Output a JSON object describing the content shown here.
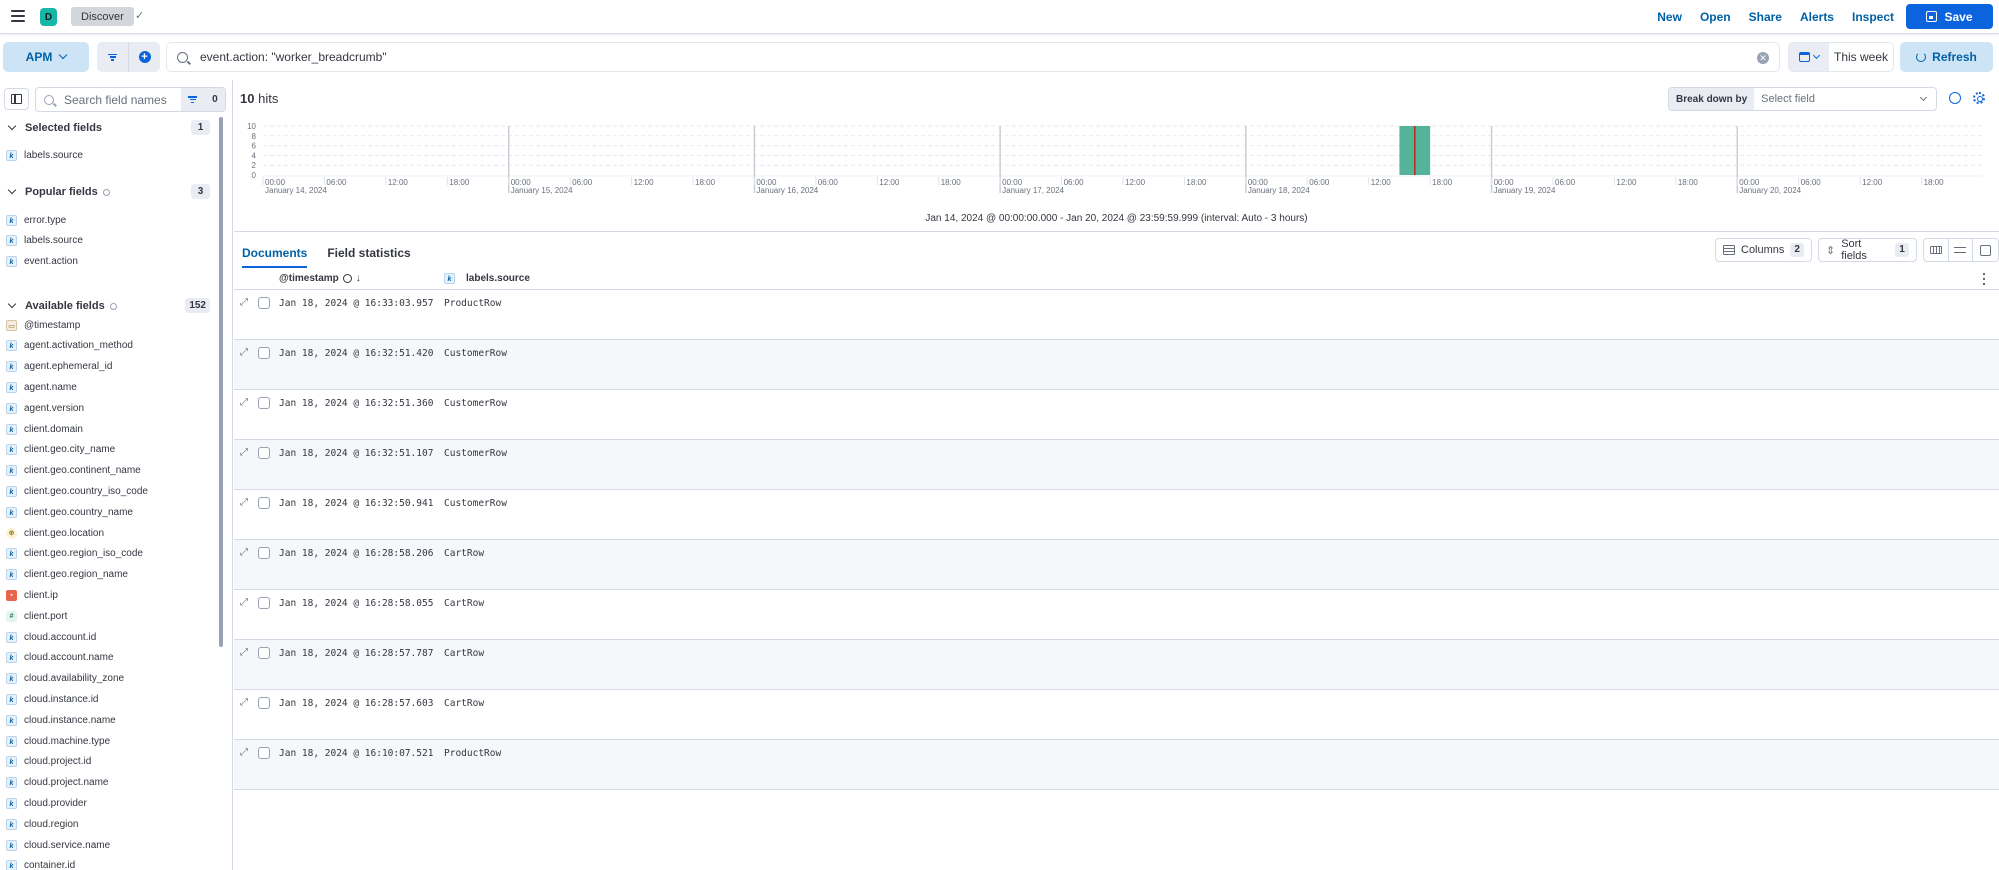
{
  "header": {
    "space_initial": "D",
    "breadcrumb": "Discover",
    "nav_links": [
      "New",
      "Open",
      "Share",
      "Alerts",
      "Inspect"
    ],
    "save_label": "Save"
  },
  "querybar": {
    "data_view": "APM",
    "query": "event.action: \"worker_breadcrumb\"",
    "date_range": "This week",
    "refresh_label": "Refresh"
  },
  "sidebar": {
    "search_placeholder": "Search field names",
    "filter_count": "0",
    "selected": {
      "title": "Selected fields",
      "count": "1",
      "fields": [
        {
          "name": "labels.source",
          "type": "k"
        }
      ]
    },
    "popular": {
      "title": "Popular fields",
      "count": "3",
      "fields": [
        {
          "name": "error.type",
          "type": "k"
        },
        {
          "name": "labels.source",
          "type": "k"
        },
        {
          "name": "event.action",
          "type": "k"
        }
      ]
    },
    "available": {
      "title": "Available fields",
      "count": "152",
      "fields": [
        {
          "name": "@timestamp",
          "type": "date"
        },
        {
          "name": "agent.activation_method",
          "type": "k"
        },
        {
          "name": "agent.ephemeral_id",
          "type": "k"
        },
        {
          "name": "agent.name",
          "type": "k"
        },
        {
          "name": "agent.version",
          "type": "k"
        },
        {
          "name": "client.domain",
          "type": "k"
        },
        {
          "name": "client.geo.city_name",
          "type": "k"
        },
        {
          "name": "client.geo.continent_name",
          "type": "k"
        },
        {
          "name": "client.geo.country_iso_code",
          "type": "k"
        },
        {
          "name": "client.geo.country_name",
          "type": "k"
        },
        {
          "name": "client.geo.location",
          "type": "geo"
        },
        {
          "name": "client.geo.region_iso_code",
          "type": "k"
        },
        {
          "name": "client.geo.region_name",
          "type": "k"
        },
        {
          "name": "client.ip",
          "type": "ip"
        },
        {
          "name": "client.port",
          "type": "num"
        },
        {
          "name": "cloud.account.id",
          "type": "k"
        },
        {
          "name": "cloud.account.name",
          "type": "k"
        },
        {
          "name": "cloud.availability_zone",
          "type": "k"
        },
        {
          "name": "cloud.instance.id",
          "type": "k"
        },
        {
          "name": "cloud.instance.name",
          "type": "k"
        },
        {
          "name": "cloud.machine.type",
          "type": "k"
        },
        {
          "name": "cloud.project.id",
          "type": "k"
        },
        {
          "name": "cloud.project.name",
          "type": "k"
        },
        {
          "name": "cloud.provider",
          "type": "k"
        },
        {
          "name": "cloud.region",
          "type": "k"
        },
        {
          "name": "cloud.service.name",
          "type": "k"
        },
        {
          "name": "container.id",
          "type": "k"
        }
      ]
    }
  },
  "main": {
    "hits_count": "10",
    "hits_label": "hits",
    "breakdown_label": "Break down by",
    "breakdown_placeholder": "Select field",
    "chart_caption": "Jan 14, 2024 @ 00:00:00.000 - Jan 20, 2024 @ 23:59:59.999 (interval: Auto - 3 hours)",
    "tabs": [
      {
        "label": "Documents",
        "active": true
      },
      {
        "label": "Field statistics",
        "active": false
      }
    ],
    "columns_label": "Columns",
    "columns_count": "2",
    "sort_label": "Sort fields",
    "sort_count": "1",
    "grid_columns": [
      "@timestamp",
      "labels.source"
    ],
    "rows": [
      {
        "timestamp": "Jan 18, 2024 @ 16:33:03.957",
        "source": "ProductRow"
      },
      {
        "timestamp": "Jan 18, 2024 @ 16:32:51.420",
        "source": "CustomerRow"
      },
      {
        "timestamp": "Jan 18, 2024 @ 16:32:51.360",
        "source": "CustomerRow"
      },
      {
        "timestamp": "Jan 18, 2024 @ 16:32:51.107",
        "source": "CustomerRow"
      },
      {
        "timestamp": "Jan 18, 2024 @ 16:32:50.941",
        "source": "CustomerRow"
      },
      {
        "timestamp": "Jan 18, 2024 @ 16:28:58.206",
        "source": "CartRow"
      },
      {
        "timestamp": "Jan 18, 2024 @ 16:28:58.055",
        "source": "CartRow"
      },
      {
        "timestamp": "Jan 18, 2024 @ 16:28:57.787",
        "source": "CartRow"
      },
      {
        "timestamp": "Jan 18, 2024 @ 16:28:57.603",
        "source": "CartRow"
      },
      {
        "timestamp": "Jan 18, 2024 @ 16:10:07.521",
        "source": "ProductRow"
      }
    ]
  },
  "chart_data": {
    "type": "bar",
    "title": "",
    "xlabel": "",
    "ylabel": "",
    "x_range_hours": [
      0,
      168
    ],
    "x_start": "January 14, 2024 00:00",
    "interval_hours": 3,
    "ylim": [
      0,
      10
    ],
    "y_ticks": [
      0,
      2,
      4,
      6,
      8,
      10
    ],
    "grid": true,
    "day_labels": [
      "January 14, 2024",
      "January 15, 2024",
      "January 16, 2024",
      "January 17, 2024",
      "January 18, 2024",
      "January 19, 2024",
      "January 20, 2024"
    ],
    "hour_ticks": [
      "00:00",
      "06:00",
      "12:00",
      "18:00"
    ],
    "bars": [
      {
        "start": "Jan 18, 2024 15:00",
        "start_hour": 111,
        "end_hour": 114,
        "value": 10
      }
    ],
    "bar_color": "#54b399",
    "cursor_marker_hour": 112.5,
    "cursor_color": "#bd271e"
  }
}
